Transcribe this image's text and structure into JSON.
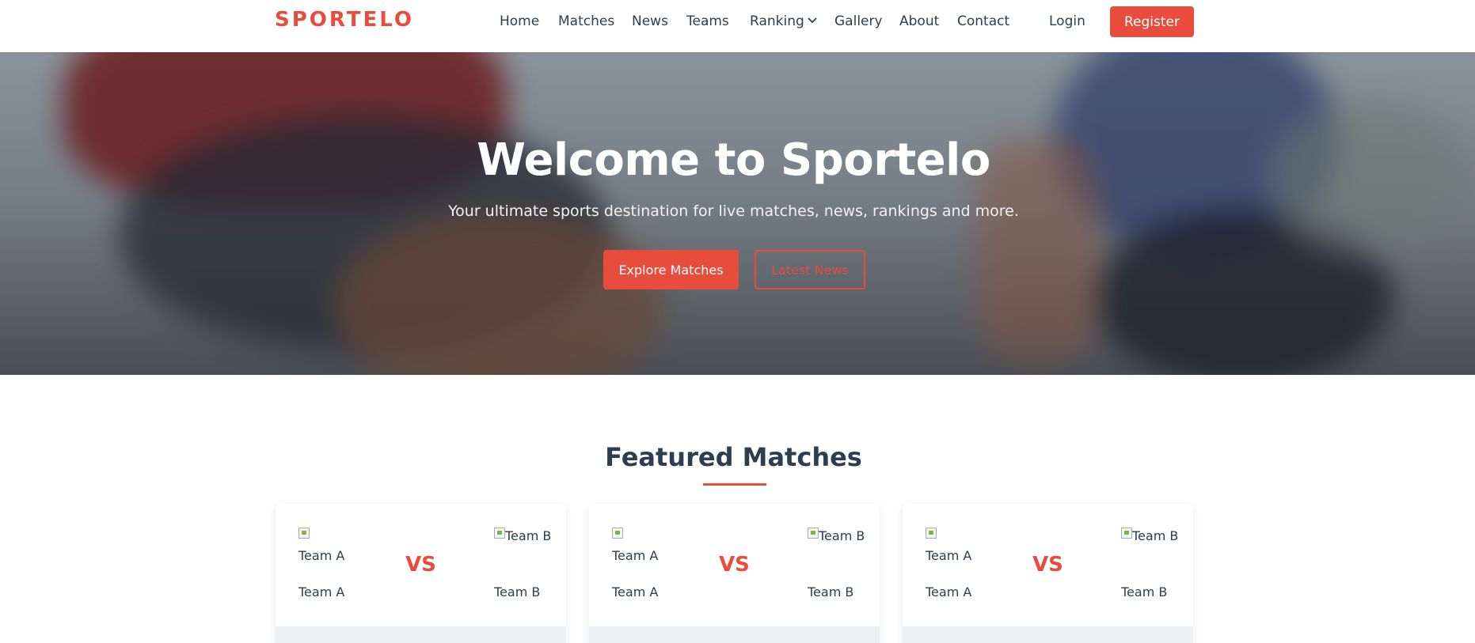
{
  "header": {
    "logo": "SPORTELO",
    "nav": [
      "Home",
      "Matches",
      "News",
      "Teams",
      "Ranking",
      "Gallery",
      "About",
      "Contact"
    ],
    "login": "Login",
    "register": "Register"
  },
  "hero": {
    "title": "Welcome to Sportelo",
    "subtitle": "Your ultimate sports destination for live matches, news, rankings and more.",
    "primary_button": "Explore Matches",
    "secondary_button": "Latest News"
  },
  "featured": {
    "title": "Featured Matches",
    "matches": [
      {
        "team_a_alt": "Team A",
        "team_b_alt": "Team B",
        "team_a": "Team A",
        "team_b": "Team B",
        "vs": "VS"
      },
      {
        "team_a_alt": "Team A",
        "team_b_alt": "Team B",
        "team_a": "Team A",
        "team_b": "Team B",
        "vs": "VS"
      },
      {
        "team_a_alt": "Team A",
        "team_b_alt": "Team B",
        "team_a": "Team A",
        "team_b": "Team B",
        "vs": "VS"
      }
    ]
  },
  "colors": {
    "accent": "#e74c3c",
    "text": "#2c3e50"
  }
}
